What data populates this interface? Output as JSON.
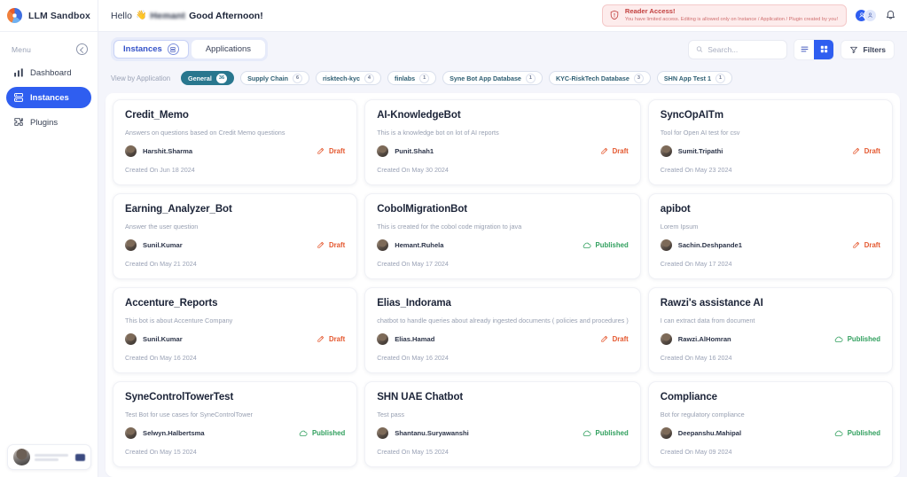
{
  "brand": {
    "name": "LLM Sandbox",
    "logo_icon": "sandbox-logo-icon"
  },
  "sidebar": {
    "menu_label": "Menu",
    "collapse_icon": "collapse-chevron-icon",
    "items": [
      {
        "label": "Dashboard",
        "icon": "bar-chart-icon",
        "active": false
      },
      {
        "label": "Instances",
        "icon": "server-stack-icon",
        "active": true
      },
      {
        "label": "Plugins",
        "icon": "puzzle-piece-icon",
        "active": false
      }
    ]
  },
  "topbar": {
    "hello": "Hello",
    "wave_icon": "waving-hand-icon",
    "username": "Hemant",
    "good_afternoon": "Good Afternoon!",
    "alert": {
      "icon": "shield-alert-icon",
      "title": "Reader Access!",
      "message": "You have limited access. Editing is allowed only on Instance / Application / Plugin created by you!",
      "bg_color": "#fdecec",
      "border_color": "#f4c9c9",
      "title_color": "#c2403f"
    },
    "avatars": [
      {
        "name": "user-avatar-primary",
        "initial": "",
        "color": "#2f5ef0"
      },
      {
        "name": "user-avatar-secondary",
        "initial": "",
        "color": "#dfe6fb"
      }
    ],
    "bell_icon": "notification-bell-icon"
  },
  "controls": {
    "tabs": [
      {
        "label": "Instances",
        "count": "",
        "active": true,
        "icon": "instances-badge-icon"
      },
      {
        "label": "Applications",
        "count": "",
        "active": false,
        "icon": ""
      }
    ],
    "search": {
      "placeholder": "Search...",
      "value": "",
      "icon": "search-icon"
    },
    "view_list_icon": "list-view-icon",
    "view_grid_icon": "grid-view-icon",
    "view_active": "grid",
    "filters": {
      "label": "Filters",
      "icon": "filter-funnel-icon"
    }
  },
  "filter_bar": {
    "label": "View by Application",
    "chips": [
      {
        "label": "General",
        "count": "36",
        "active": true
      },
      {
        "label": "Supply Chain",
        "count": "6",
        "active": false
      },
      {
        "label": "risktech-kyc",
        "count": "4",
        "active": false
      },
      {
        "label": "finlabs",
        "count": "1",
        "active": false
      },
      {
        "label": "Syne Bot App Database",
        "count": "1",
        "active": false
      },
      {
        "label": "KYC-RiskTech Database",
        "count": "3",
        "active": false
      },
      {
        "label": "SHN App Test 1",
        "count": "1",
        "active": false
      }
    ],
    "active_color": "#29778e"
  },
  "cards": [
    {
      "title": "Credit_Memo",
      "description": "Answers on questions based on Credit Memo questions",
      "owner": "Harshit.Sharma",
      "status": "Draft",
      "status_type": "draft",
      "status_icon": "draft-pencil-icon",
      "created": "Created On Jun 18 2024"
    },
    {
      "title": "AI-KnowledgeBot",
      "description": "This is a knowledge bot on lot of AI reports",
      "owner": "Punit.Shah1",
      "status": "Draft",
      "status_type": "draft",
      "status_icon": "draft-pencil-icon",
      "created": "Created On May 30 2024"
    },
    {
      "title": "SyncOpAITm",
      "description": "Tool for Open AI test for csv",
      "owner": "Sumit.Tripathi",
      "status": "Draft",
      "status_type": "draft",
      "status_icon": "draft-pencil-icon",
      "created": "Created On May 23 2024"
    },
    {
      "title": "Earning_Analyzer_Bot",
      "description": "Answer the user question",
      "owner": "Sunil.Kumar",
      "status": "Draft",
      "status_type": "draft",
      "status_icon": "draft-pencil-icon",
      "created": "Created On May 21 2024"
    },
    {
      "title": "CobolMigrationBot",
      "description": "This is created for the cobol code migration to java",
      "owner": "Hemant.Ruhela",
      "status": "Published",
      "status_type": "published",
      "status_icon": "published-cloud-icon",
      "created": "Created On May 17 2024"
    },
    {
      "title": "apibot",
      "description": "Lorem Ipsum",
      "owner": "Sachin.Deshpande1",
      "status": "Draft",
      "status_type": "draft",
      "status_icon": "draft-pencil-icon",
      "created": "Created On May 17 2024"
    },
    {
      "title": "Accenture_Reports",
      "description": "This bot is about Accenture Company",
      "owner": "Sunil.Kumar",
      "status": "Draft",
      "status_type": "draft",
      "status_icon": "draft-pencil-icon",
      "created": "Created On May 16 2024"
    },
    {
      "title": "Elias_Indorama",
      "description": "chatbot to handle queries about already ingested documents ( policies and procedures )",
      "owner": "Elias.Hamad",
      "status": "Draft",
      "status_type": "draft",
      "status_icon": "draft-pencil-icon",
      "created": "Created On May 16 2024"
    },
    {
      "title": "Rawzi's assistance AI",
      "description": "I can extract data from document",
      "owner": "Rawzi.AlHomran",
      "status": "Published",
      "status_type": "published",
      "status_icon": "published-cloud-icon",
      "created": "Created On May 16 2024"
    },
    {
      "title": "SyneControlTowerTest",
      "description": "Test Bot for use cases for SyneControlTower",
      "owner": "Selwyn.Halbertsma",
      "status": "Published",
      "status_type": "published",
      "status_icon": "published-cloud-icon",
      "created": "Created On May 15 2024"
    },
    {
      "title": "SHN UAE Chatbot",
      "description": "Test pass",
      "owner": "Shantanu.Suryawanshi",
      "status": "Published",
      "status_type": "published",
      "status_icon": "published-cloud-icon",
      "created": "Created On May 15 2024"
    },
    {
      "title": "Compliance",
      "description": "Bot for regulatory compliance",
      "owner": "Deepanshu.Mahipal",
      "status": "Published",
      "status_type": "published",
      "status_icon": "published-cloud-icon",
      "created": "Created On May 09 2024"
    }
  ],
  "theme": {
    "accent": "#2f5ef0",
    "teal": "#29778e",
    "draft": "#e4572e",
    "published": "#32a05f",
    "page_bg": "#f4f5fb"
  }
}
